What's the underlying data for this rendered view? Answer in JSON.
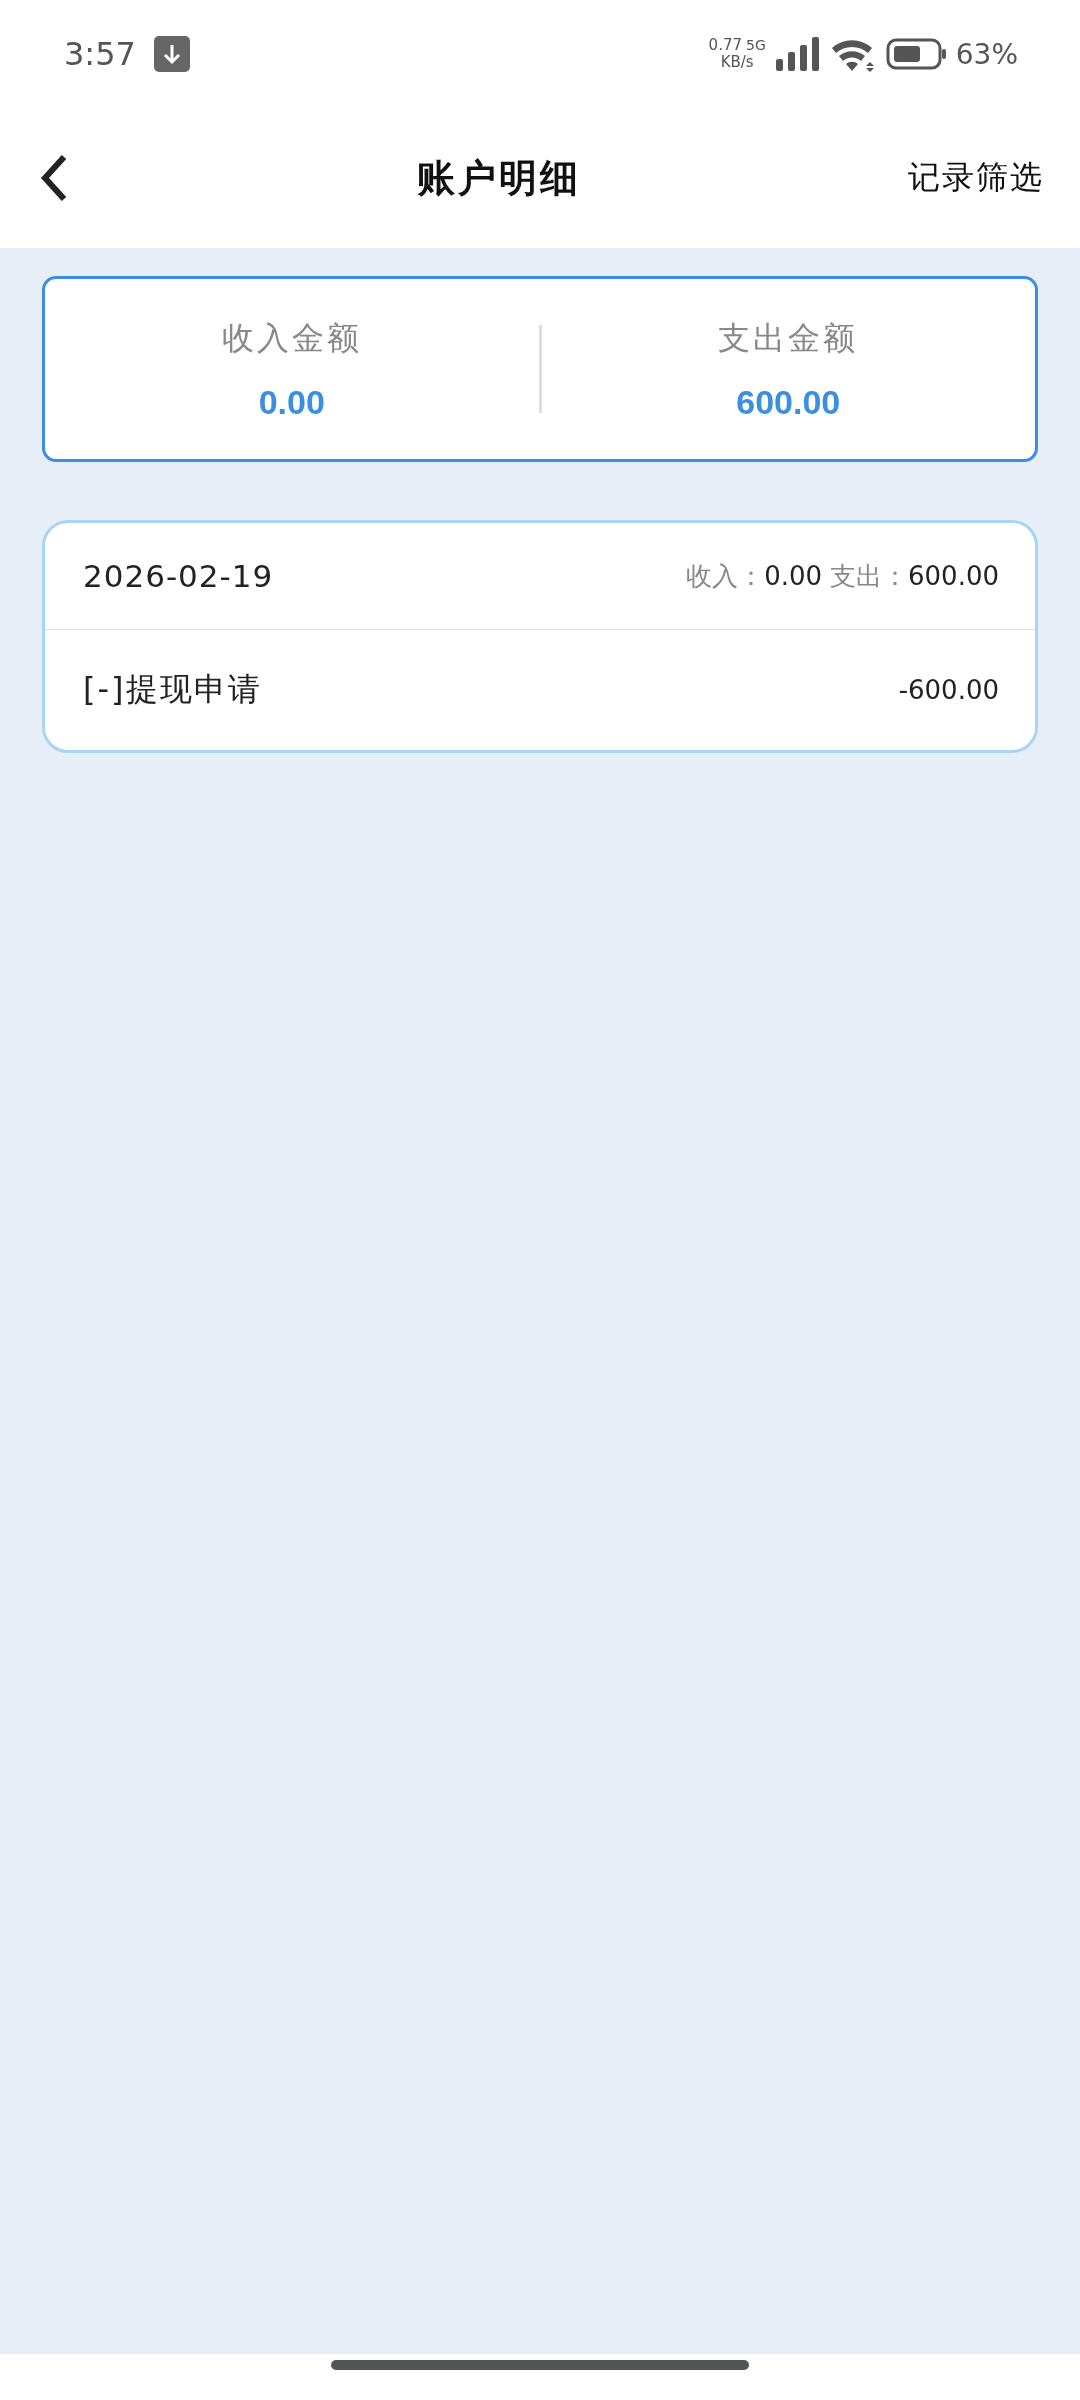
{
  "status_bar": {
    "time": "3:57",
    "speed_value": "0.77",
    "speed_unit": "KB/s",
    "network": "5G",
    "battery": "63%"
  },
  "header": {
    "title": "账户明细",
    "action": "记录筛选"
  },
  "summary": [
    {
      "label": "收入金额",
      "value": "0.00"
    },
    {
      "label": "支出金额",
      "value": "600.00"
    }
  ],
  "groups": [
    {
      "date": "2026-02-19",
      "income_label": "收入：",
      "income": "0.00",
      "expense_label": "支出：",
      "expense": "600.00",
      "entries": [
        {
          "title": "[-]提现申请",
          "amount": "-600.00"
        }
      ]
    }
  ]
}
